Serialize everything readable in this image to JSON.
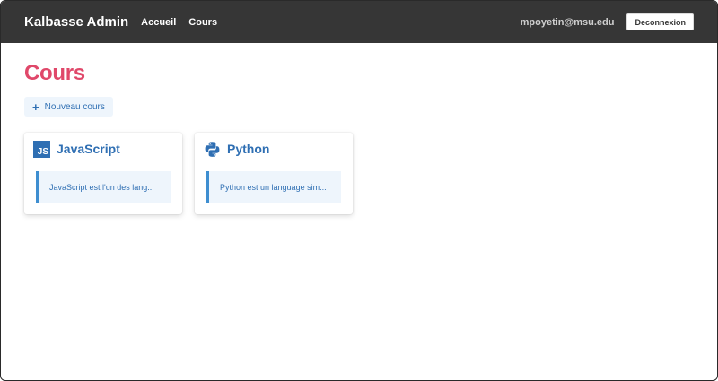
{
  "navbar": {
    "brand": "Kalbasse Admin",
    "links": [
      "Accueil",
      "Cours"
    ],
    "user_email": "mpoyetin@msu.edu",
    "logout_label": "Deconnexion"
  },
  "page": {
    "title": "Cours",
    "new_button_label": "Nouveau cours",
    "new_button_icon": "plus-icon"
  },
  "courses": [
    {
      "title": "JavaScript",
      "icon": "javascript-icon",
      "icon_text": "JS",
      "description": "JavaScript est l'un des lang..."
    },
    {
      "title": "Python",
      "icon": "python-icon",
      "description": "Python est un language sim..."
    }
  ],
  "colors": {
    "navbar_bg": "#363636",
    "title_accent": "#e0486a",
    "link_blue": "#2f6fb3",
    "light_blue_bg": "#eef5fc",
    "desc_border": "#3e8ed0"
  }
}
